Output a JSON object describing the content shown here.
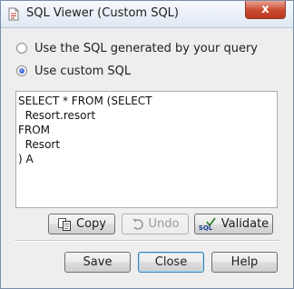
{
  "window": {
    "title": "SQL Viewer (Custom SQL)",
    "close_glyph": "x"
  },
  "options": [
    {
      "label": "Use the SQL generated by your query",
      "checked": false
    },
    {
      "label": "Use custom SQL",
      "checked": true
    }
  ],
  "sql": {
    "lines": [
      "SELECT * FROM (SELECT",
      "  Resort.resort",
      "FROM",
      "  Resort",
      ") A"
    ]
  },
  "actions": {
    "copy_label": "Copy",
    "undo_label": "Undo",
    "validate_label": "Validate",
    "validate_icon_text": "SQL"
  },
  "footer": {
    "save_label": "Save",
    "close_label": "Close",
    "help_label": "Help"
  }
}
